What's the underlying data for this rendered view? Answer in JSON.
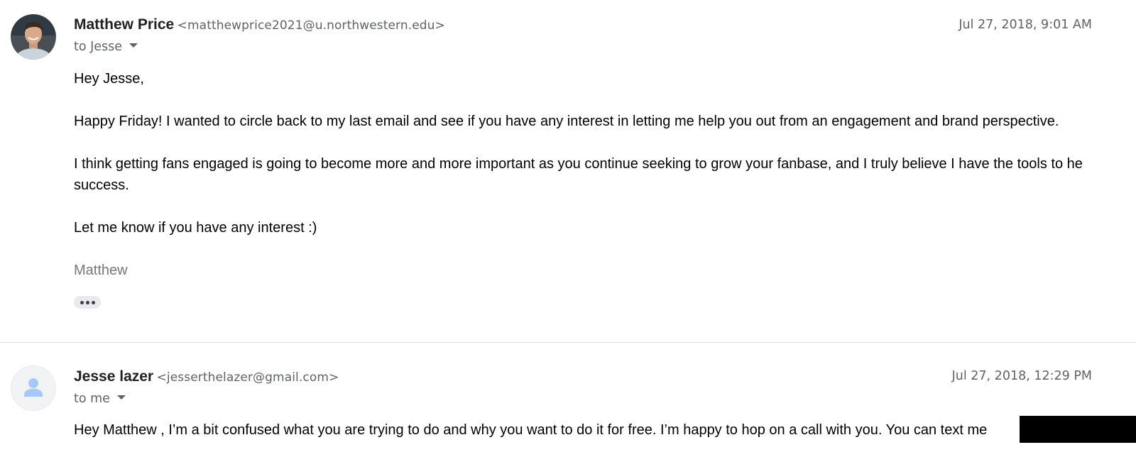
{
  "messages": [
    {
      "sender_name": "Matthew Price",
      "sender_email": "<matthewprice2021@u.northwestern.edu>",
      "recipient": "to Jesse",
      "timestamp": "Jul 27, 2018, 9:01 AM",
      "avatar_icon": "profile-photo",
      "body": {
        "greeting": "Hey Jesse,",
        "p1": "Happy Friday! I wanted to circle back to my last email and see if you have any interest in letting me help you out from an engagement and brand perspective.",
        "p2_line1": "I think getting fans engaged is going to become more and more important as you continue seeking to grow your fanbase, and I truly believe I have the tools to he",
        "p2_line2": "success.",
        "p3": "Let me know if you have any interest :)",
        "signature": "Matthew"
      },
      "show_trimmed_icon": "more-horizontal-icon"
    },
    {
      "sender_name": "Jesse lazer",
      "sender_email": "<jesserthelazer@gmail.com>",
      "recipient": "to me",
      "timestamp": "Jul 27, 2018, 12:29 PM",
      "avatar_icon": "default-person-icon",
      "body": {
        "p1": "Hey Matthew , I’m a bit confused what you are trying to do and why you want to do it for free. I’m happy to hop on a call with you. You can text me"
      }
    }
  ],
  "colors": {
    "text_primary": "#202124",
    "text_secondary": "#5f6368",
    "signature": "#777777",
    "default_avatar": "#a8c7fa"
  }
}
